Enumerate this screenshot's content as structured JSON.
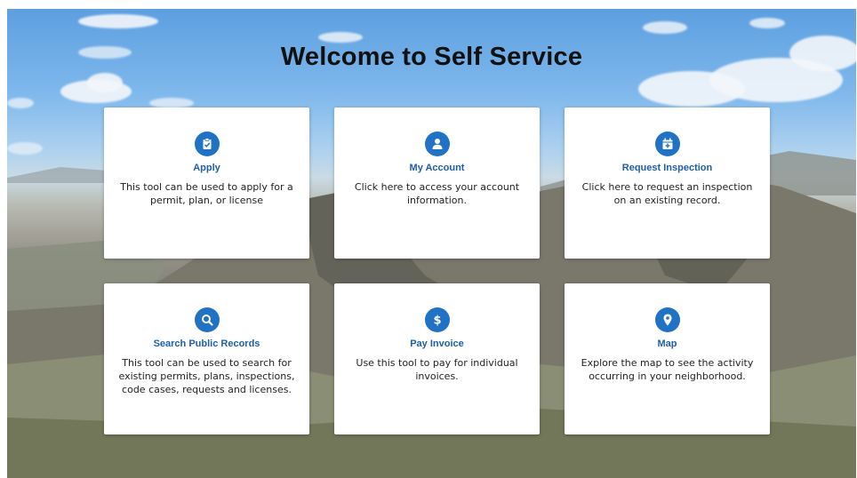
{
  "page": {
    "title": "Welcome to Self Service"
  },
  "colors": {
    "accent": "#1f72c4",
    "card_title": "#1e5fa8",
    "card_bg": "#ffffff"
  },
  "cards": [
    {
      "title": "Apply",
      "description": "This tool can be used to apply for a permit, plan, or license",
      "icon": "clipboard-check-icon"
    },
    {
      "title": "My Account",
      "description": "Click here to access your account information.",
      "icon": "user-icon"
    },
    {
      "title": "Request Inspection",
      "description": "Click here to request an inspection on an existing record.",
      "icon": "calendar-plus-icon"
    },
    {
      "title": "Search Public Records",
      "description": "This tool can be used to search for existing permits, plans, inspections, code cases, requests and licenses.",
      "icon": "search-icon"
    },
    {
      "title": "Pay Invoice",
      "description": "Use this tool to pay for individual invoices.",
      "icon": "dollar-icon"
    },
    {
      "title": "Map",
      "description": "Explore the map to see the activity occurring in your neighborhood.",
      "icon": "map-pin-icon"
    }
  ]
}
